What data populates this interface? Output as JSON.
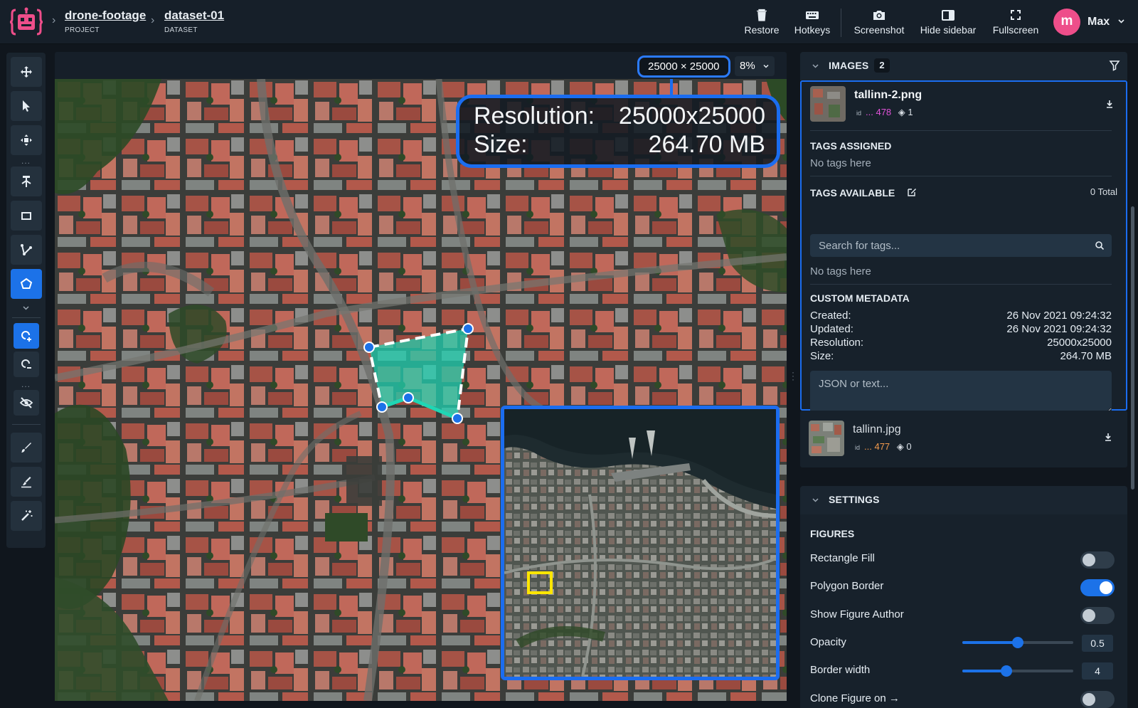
{
  "header": {
    "breadcrumbs": [
      {
        "name": "drone-footage",
        "kind": "PROJECT"
      },
      {
        "name": "dataset-01",
        "kind": "DATASET"
      }
    ],
    "actions": [
      {
        "label": "Restore",
        "icon": "trash-icon"
      },
      {
        "label": "Hotkeys",
        "icon": "keyboard-icon"
      },
      {
        "label": "Screenshot",
        "icon": "camera-icon"
      },
      {
        "label": "Hide sidebar",
        "icon": "sidebar-icon"
      },
      {
        "label": "Fullscreen",
        "icon": "fullscreen-icon"
      }
    ],
    "user": {
      "initial": "m",
      "name": "Max",
      "avatar_color": "#ee4e8a"
    }
  },
  "canvas": {
    "resolution_pill": "25000 × 25000",
    "zoom": "8%",
    "info": {
      "resolution_label": "Resolution:",
      "resolution_value": "25000x25000",
      "size_label": "Size:",
      "size_value": "264.70 MB"
    },
    "annotation_color": "#1fd6b4"
  },
  "sidebar": {
    "images": {
      "title": "IMAGES",
      "count": "2",
      "items": [
        {
          "name": "tallinn-2.png",
          "id_label": "id",
          "id": "... 478",
          "layers": "1"
        },
        {
          "name": "tallinn.jpg",
          "id_label": "id",
          "id": "... 477",
          "layers": "0"
        }
      ]
    },
    "tags_assigned": {
      "title": "TAGS ASSIGNED",
      "empty": "No tags here"
    },
    "tags_available": {
      "title": "TAGS AVAILABLE",
      "total": "0 Total",
      "search_placeholder": "Search for tags...",
      "empty": "No tags here"
    },
    "custom_metadata": {
      "title": "CUSTOM METADATA",
      "rows": [
        {
          "key": "Created:",
          "value": "26 Nov 2021 09:24:32"
        },
        {
          "key": "Updated:",
          "value": "26 Nov 2021 09:24:32"
        },
        {
          "key": "Resolution:",
          "value": "25000x25000"
        },
        {
          "key": "Size:",
          "value": "264.70 MB"
        }
      ],
      "json_placeholder": "JSON or text..."
    },
    "settings": {
      "title": "SETTINGS",
      "figures_title": "FIGURES",
      "rectangle_fill": "Rectangle Fill",
      "polygon_border": "Polygon Border",
      "show_figure_author": "Show Figure Author",
      "opacity": "Opacity",
      "opacity_value": "0.5",
      "border_width": "Border width",
      "border_width_value": "4",
      "clone_figure": "Clone Figure on →",
      "toggles": {
        "rectangle_fill": false,
        "polygon_border": true,
        "show_figure_author": false,
        "clone_figure": false
      },
      "opacity_level": 0.5,
      "border_width_level": 0.4
    }
  },
  "colors": {
    "accent": "#1c72e8",
    "highlight_border": "#1b6df0",
    "brand_pink": "#ee4e8a"
  }
}
